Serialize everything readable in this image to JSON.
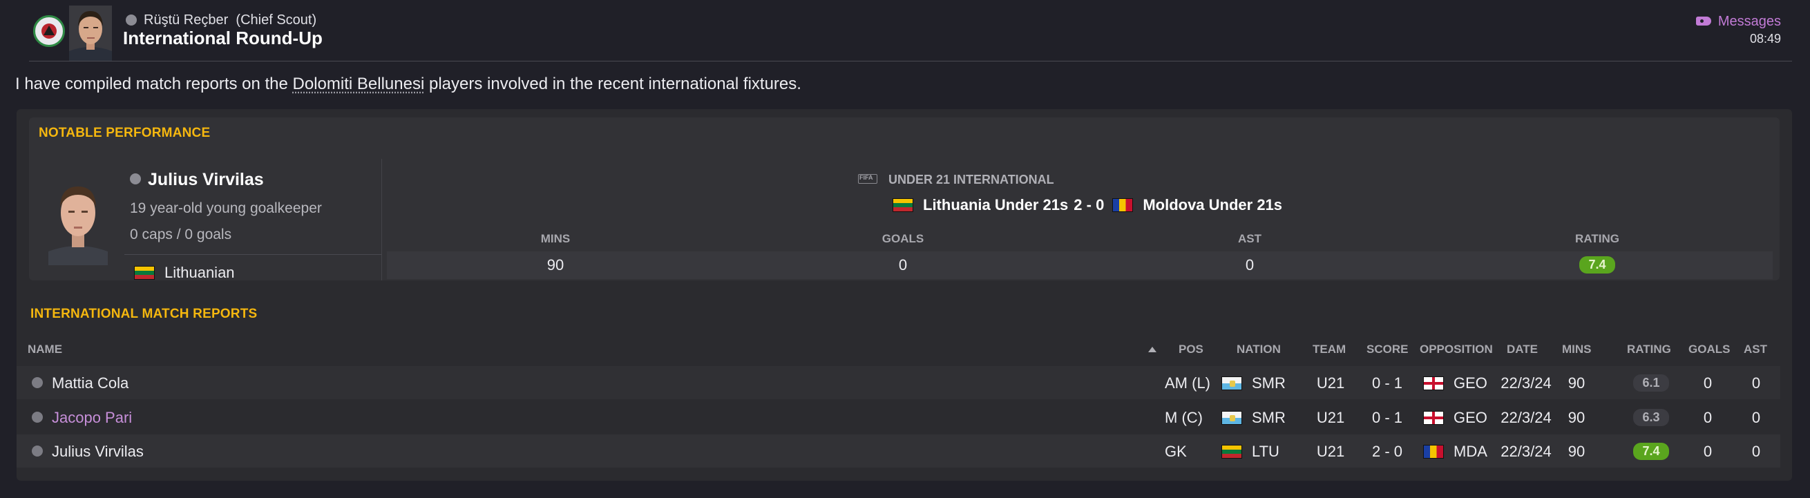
{
  "header": {
    "sender_name": "Rüştü Reçber",
    "sender_role": "(Chief Scout)",
    "title": "International Round-Up",
    "messages_label": "Messages",
    "time": "08:49"
  },
  "intro": {
    "before": "I have compiled match reports on the ",
    "club": "Dolomiti Bellunesi",
    "after": " players involved in the recent international fixtures."
  },
  "notable": {
    "section_title": "NOTABLE PERFORMANCE",
    "player_name": "Julius Virvilas",
    "description": "19 year-old young goalkeeper",
    "caps": "0 caps / 0 goals",
    "nationality": "Lithuanian",
    "competition": "UNDER 21 INTERNATIONAL",
    "home_team": "Lithuania Under 21s",
    "score": "2 - 0",
    "away_team": "Moldova Under 21s",
    "stats": {
      "mins_label": "MINS",
      "mins": "90",
      "goals_label": "GOALS",
      "goals": "0",
      "ast_label": "AST",
      "ast": "0",
      "rating_label": "RATING",
      "rating": "7.4"
    }
  },
  "reports": {
    "section_title": "INTERNATIONAL MATCH REPORTS",
    "columns": {
      "name": "NAME",
      "pos": "POS",
      "nation": "NATION",
      "team": "TEAM",
      "score": "SCORE",
      "opposition": "OPPOSITION",
      "date": "DATE",
      "mins": "MINS",
      "rating": "RATING",
      "goals": "GOALS",
      "ast": "AST"
    },
    "rows": [
      {
        "name": "Mattia Cola",
        "pos": "AM (L)",
        "nation": "SMR",
        "team": "U21",
        "score": "0 - 1",
        "opposition": "GEO",
        "date": "22/3/24",
        "mins": "90",
        "rating": "6.1",
        "goals": "0",
        "ast": "0"
      },
      {
        "name": "Jacopo Pari",
        "pos": "M (C)",
        "nation": "SMR",
        "team": "U21",
        "score": "0 - 1",
        "opposition": "GEO",
        "date": "22/3/24",
        "mins": "90",
        "rating": "6.3",
        "goals": "0",
        "ast": "0"
      },
      {
        "name": "Julius Virvilas",
        "pos": "GK",
        "nation": "LTU",
        "team": "U21",
        "score": "2 - 0",
        "opposition": "MDA",
        "date": "22/3/24",
        "mins": "90",
        "rating": "7.4",
        "goals": "0",
        "ast": "0"
      }
    ]
  },
  "colors": {
    "accent": "#f5b70f",
    "messages": "#c27bd6",
    "rating_good": "#5aa51e",
    "link": "#c78fd9"
  },
  "icons": [
    "club-badge-icon",
    "person-icon",
    "tag-icon",
    "fifa-icon",
    "sort-ascending-icon",
    "flag-ltu-icon",
    "flag-mda-icon",
    "flag-smr-icon",
    "flag-geo-icon"
  ]
}
